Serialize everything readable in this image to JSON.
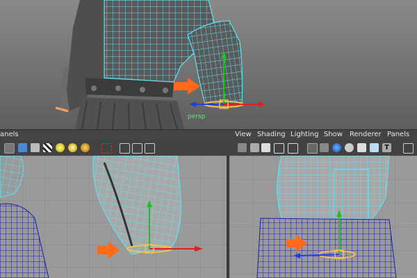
{
  "viewports": {
    "top": {
      "camera_label": "persp"
    }
  },
  "panel_menu": {
    "left_fragment": "anels",
    "items": [
      "View",
      "Shading",
      "Lighting",
      "Show",
      "Renderer",
      "Panels"
    ]
  },
  "toolbar": {
    "text_icon_label": "T"
  },
  "colors": {
    "wireframe": "#5fe2f2",
    "dark_wire": "#1f1fa0",
    "manip_x": "#e02020",
    "manip_y": "#20c020",
    "manip_z": "#1f3fe0",
    "arrow": "#ff6a1a",
    "selection": "#f0c050"
  }
}
